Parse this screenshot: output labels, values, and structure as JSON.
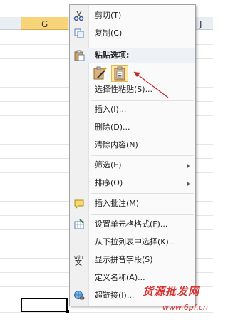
{
  "sheet": {
    "columns": [
      {
        "label": "G",
        "selected": true
      },
      {
        "label": "J",
        "selected": false
      }
    ]
  },
  "context_menu": {
    "items": [
      {
        "label": "剪切(T)",
        "icon": "scissors-icon"
      },
      {
        "label": "复制(C)",
        "icon": "copy-icon"
      },
      {
        "label": "选择性粘贴(S)...",
        "icon": ""
      },
      {
        "label": "插入(I)...",
        "icon": ""
      },
      {
        "label": "删除(D)...",
        "icon": ""
      },
      {
        "label": "清除内容(N)",
        "icon": ""
      },
      {
        "label": "筛选(E)",
        "icon": "",
        "submenu": true
      },
      {
        "label": "排序(O)",
        "icon": "",
        "submenu": true
      },
      {
        "label": "插入批注(M)",
        "icon": "comment-icon"
      },
      {
        "label": "设置单元格格式(F)...",
        "icon": "format-cells-icon"
      },
      {
        "label": "从下拉列表中选择(K)...",
        "icon": ""
      },
      {
        "label": "显示拼音字段(S)",
        "icon": "phonetic-icon"
      },
      {
        "label": "定义名称(A)...",
        "icon": ""
      },
      {
        "label": "超链接(I)...",
        "icon": "hyperlink-icon"
      }
    ],
    "paste_header": "粘贴选项:",
    "paste_options": [
      {
        "icon": "paste-formatting-icon"
      },
      {
        "icon": "paste-values-icon",
        "highlighted": true
      }
    ]
  },
  "watermark": {
    "title": "货源批发网",
    "url": "www.6pf.cn"
  },
  "colors": {
    "selected_column": "#f7d47a",
    "annotation_arrow": "#c0272d"
  }
}
